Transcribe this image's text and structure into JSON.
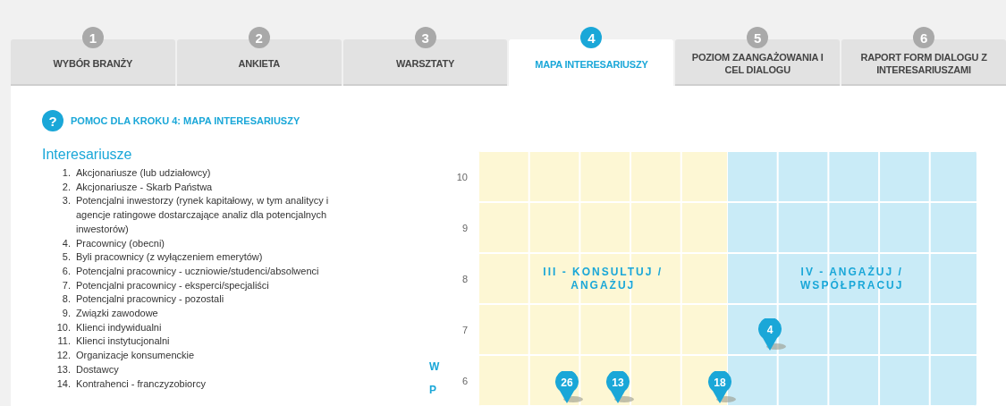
{
  "tabs": [
    {
      "step": "1",
      "label": "WYBÓR BRANŻY",
      "selected": false
    },
    {
      "step": "2",
      "label": "ANKIETA",
      "selected": false
    },
    {
      "step": "3",
      "label": "WARSZTATY",
      "selected": false
    },
    {
      "step": "4",
      "label": "MAPA INTERESARIUSZY",
      "selected": true
    },
    {
      "step": "5",
      "label": "POZIOM ZAANGAŻOWANIA I CEL DIALOGU",
      "selected": false
    },
    {
      "step": "6",
      "label": "RAPORT FORM DIALOGU Z INTERESARIUSZAMI",
      "selected": false
    }
  ],
  "help": {
    "icon": "?",
    "title": "POMOC DLA KROKU 4: MAPA INTERESARIUSZY"
  },
  "stakeholders": {
    "title": "Interesariusze",
    "items": [
      {
        "number": "1.",
        "text": "Akcjonariusze (lub udziałowcy)"
      },
      {
        "number": "2.",
        "text": "Akcjonariusze - Skarb Państwa"
      },
      {
        "number": "3.",
        "text": "Potencjalni inwestorzy (rynek kapitałowy, w tym analitycy i agencje ratingowe dostarczające analiz dla potencjalnych inwestorów)"
      },
      {
        "number": "4.",
        "text": "Pracownicy (obecni)"
      },
      {
        "number": "5.",
        "text": "Byli pracownicy (z wyłączeniem emerytów)"
      },
      {
        "number": "6.",
        "text": "Potencjalni pracownicy - uczniowie/studenci/absolwenci"
      },
      {
        "number": "7.",
        "text": "Potencjalni pracownicy - eksperci/specjaliści"
      },
      {
        "number": "8.",
        "text": "Potencjalni pracownicy - pozostali"
      },
      {
        "number": "9.",
        "text": "Związki zawodowe"
      },
      {
        "number": "10.",
        "text": "Klienci indywidualni"
      },
      {
        "number": "11.",
        "text": "Klienci instytucjonalni"
      },
      {
        "number": "12.",
        "text": "Organizacje konsumenckie"
      },
      {
        "number": "13.",
        "text": "Dostawcy"
      },
      {
        "number": "14.",
        "text": "Kontrahenci - franczyzobiorcy"
      }
    ]
  },
  "map": {
    "axis_title": "WP",
    "row_labels": [
      "10",
      "9",
      "8",
      "7",
      "6"
    ],
    "quadrants": [
      {
        "label": "III - KONSULTUJ / ANGAŻUJ",
        "color": "#fdf7d4"
      },
      {
        "label": "IV - ANGAŻUJ / WSPÓŁPRACUJ",
        "color": "#c9ebf7"
      }
    ],
    "pins": [
      {
        "label": "4"
      },
      {
        "label": "26"
      },
      {
        "label": "13"
      },
      {
        "label": "18"
      }
    ]
  }
}
